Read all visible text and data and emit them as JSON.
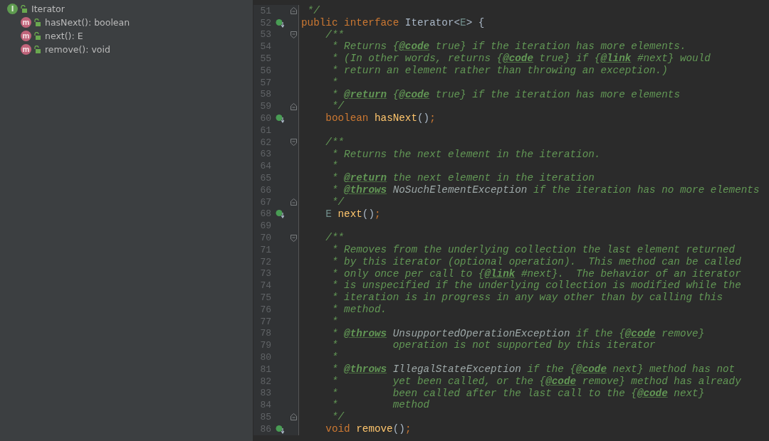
{
  "structure": {
    "items": [
      {
        "kind": "interface",
        "badge": "I",
        "label": "Iterator",
        "children": [
          {
            "kind": "method",
            "badge": "m",
            "label": "hasNext(): boolean"
          },
          {
            "kind": "method",
            "badge": "m",
            "label": "next(): E"
          },
          {
            "kind": "method",
            "badge": "m",
            "label": "remove(): void"
          }
        ]
      }
    ]
  },
  "editor": {
    "lines": [
      {
        "number": "51",
        "implemented": false,
        "fold_start": false,
        "fold_end": true,
        "tokens": [
          {
            "kind": "doc",
            "text": " */"
          }
        ]
      },
      {
        "number": "52",
        "implemented": true,
        "fold_start": false,
        "fold_end": false,
        "tokens": [
          {
            "kind": "keyword",
            "text": "public interface "
          },
          {
            "kind": "plain",
            "text": "Iterator<"
          },
          {
            "kind": "type_param",
            "text": "E"
          },
          {
            "kind": "plain",
            "text": "> {"
          }
        ]
      },
      {
        "number": "53",
        "implemented": false,
        "fold_start": true,
        "fold_end": false,
        "tokens": [
          {
            "kind": "doc",
            "text": "    /**"
          }
        ]
      },
      {
        "number": "54",
        "implemented": false,
        "fold_start": false,
        "fold_end": false,
        "tokens": [
          {
            "kind": "doc",
            "text": "     * Returns {"
          },
          {
            "kind": "doc_tag",
            "text": "@code"
          },
          {
            "kind": "doc",
            "text": " true} if the iteration has more elements."
          }
        ]
      },
      {
        "number": "55",
        "implemented": false,
        "fold_start": false,
        "fold_end": false,
        "tokens": [
          {
            "kind": "doc",
            "text": "     * (In other words, returns {"
          },
          {
            "kind": "doc_tag",
            "text": "@code"
          },
          {
            "kind": "doc",
            "text": " true} if {"
          },
          {
            "kind": "doc_tag",
            "text": "@link"
          },
          {
            "kind": "doc",
            "text": " #next} would"
          }
        ]
      },
      {
        "number": "56",
        "implemented": false,
        "fold_start": false,
        "fold_end": false,
        "tokens": [
          {
            "kind": "doc",
            "text": "     * return an element rather than throwing an exception.)"
          }
        ]
      },
      {
        "number": "57",
        "implemented": false,
        "fold_start": false,
        "fold_end": false,
        "tokens": [
          {
            "kind": "doc",
            "text": "     *"
          }
        ]
      },
      {
        "number": "58",
        "implemented": false,
        "fold_start": false,
        "fold_end": false,
        "tokens": [
          {
            "kind": "doc",
            "text": "     * "
          },
          {
            "kind": "doc_tag",
            "text": "@return"
          },
          {
            "kind": "doc",
            "text": " {"
          },
          {
            "kind": "doc_tag",
            "text": "@code"
          },
          {
            "kind": "doc",
            "text": " true} if the iteration has more elements"
          }
        ]
      },
      {
        "number": "59",
        "implemented": false,
        "fold_start": false,
        "fold_end": true,
        "tokens": [
          {
            "kind": "doc",
            "text": "     */"
          }
        ]
      },
      {
        "number": "60",
        "implemented": true,
        "fold_start": false,
        "fold_end": false,
        "tokens": [
          {
            "kind": "keyword",
            "text": "    boolean "
          },
          {
            "kind": "method",
            "text": "hasNext"
          },
          {
            "kind": "plain",
            "text": "()"
          },
          {
            "kind": "keyword",
            "text": ";"
          }
        ]
      },
      {
        "number": "61",
        "implemented": false,
        "fold_start": false,
        "fold_end": false
      },
      {
        "number": "62",
        "implemented": false,
        "fold_start": true,
        "fold_end": false,
        "tokens": [
          {
            "kind": "doc",
            "text": "    /**"
          }
        ]
      },
      {
        "number": "63",
        "implemented": false,
        "fold_start": false,
        "fold_end": false,
        "tokens": [
          {
            "kind": "doc",
            "text": "     * Returns the next element in the iteration."
          }
        ]
      },
      {
        "number": "64",
        "implemented": false,
        "fold_start": false,
        "fold_end": false,
        "tokens": [
          {
            "kind": "doc",
            "text": "     *"
          }
        ]
      },
      {
        "number": "65",
        "implemented": false,
        "fold_start": false,
        "fold_end": false,
        "tokens": [
          {
            "kind": "doc",
            "text": "     * "
          },
          {
            "kind": "doc_tag",
            "text": "@return"
          },
          {
            "kind": "doc",
            "text": " the next element in the iteration"
          }
        ]
      },
      {
        "number": "66",
        "implemented": false,
        "fold_start": false,
        "fold_end": false,
        "tokens": [
          {
            "kind": "doc",
            "text": "     * "
          },
          {
            "kind": "doc_tag",
            "text": "@throws"
          },
          {
            "kind": "doc_ref",
            "text": " NoSuchElementException"
          },
          {
            "kind": "doc",
            "text": " if the iteration has no more elements"
          }
        ]
      },
      {
        "number": "67",
        "implemented": false,
        "fold_start": false,
        "fold_end": true,
        "tokens": [
          {
            "kind": "doc",
            "text": "     */"
          }
        ]
      },
      {
        "number": "68",
        "implemented": true,
        "fold_start": false,
        "fold_end": false,
        "tokens": [
          {
            "kind": "type_param",
            "text": "    E "
          },
          {
            "kind": "method",
            "text": "next"
          },
          {
            "kind": "plain",
            "text": "()"
          },
          {
            "kind": "keyword",
            "text": ";"
          }
        ]
      },
      {
        "number": "69",
        "implemented": false,
        "fold_start": false,
        "fold_end": false
      },
      {
        "number": "70",
        "implemented": false,
        "fold_start": true,
        "fold_end": false,
        "tokens": [
          {
            "kind": "doc",
            "text": "    /**"
          }
        ]
      },
      {
        "number": "71",
        "implemented": false,
        "fold_start": false,
        "fold_end": false,
        "tokens": [
          {
            "kind": "doc",
            "text": "     * Removes from the underlying collection the last element returned"
          }
        ]
      },
      {
        "number": "72",
        "implemented": false,
        "fold_start": false,
        "fold_end": false,
        "tokens": [
          {
            "kind": "doc",
            "text": "     * by this iterator (optional operation).  This method can be called"
          }
        ]
      },
      {
        "number": "73",
        "implemented": false,
        "fold_start": false,
        "fold_end": false,
        "tokens": [
          {
            "kind": "doc",
            "text": "     * only once per call to {"
          },
          {
            "kind": "doc_tag",
            "text": "@link"
          },
          {
            "kind": "doc",
            "text": " #next}.  The behavior of an iterator"
          }
        ]
      },
      {
        "number": "74",
        "implemented": false,
        "fold_start": false,
        "fold_end": false,
        "tokens": [
          {
            "kind": "doc",
            "text": "     * is unspecified if the underlying collection is modified while the"
          }
        ]
      },
      {
        "number": "75",
        "implemented": false,
        "fold_start": false,
        "fold_end": false,
        "tokens": [
          {
            "kind": "doc",
            "text": "     * iteration is in progress in any way other than by calling this"
          }
        ]
      },
      {
        "number": "76",
        "implemented": false,
        "fold_start": false,
        "fold_end": false,
        "tokens": [
          {
            "kind": "doc",
            "text": "     * method."
          }
        ]
      },
      {
        "number": "77",
        "implemented": false,
        "fold_start": false,
        "fold_end": false,
        "tokens": [
          {
            "kind": "doc",
            "text": "     *"
          }
        ]
      },
      {
        "number": "78",
        "implemented": false,
        "fold_start": false,
        "fold_end": false,
        "tokens": [
          {
            "kind": "doc",
            "text": "     * "
          },
          {
            "kind": "doc_tag",
            "text": "@throws"
          },
          {
            "kind": "doc_ref",
            "text": " UnsupportedOperationException"
          },
          {
            "kind": "doc",
            "text": " if the {"
          },
          {
            "kind": "doc_tag",
            "text": "@code"
          },
          {
            "kind": "doc",
            "text": " remove}"
          }
        ]
      },
      {
        "number": "79",
        "implemented": false,
        "fold_start": false,
        "fold_end": false,
        "tokens": [
          {
            "kind": "doc",
            "text": "     *         operation is not supported by this iterator"
          }
        ]
      },
      {
        "number": "80",
        "implemented": false,
        "fold_start": false,
        "fold_end": false,
        "tokens": [
          {
            "kind": "doc",
            "text": "     *"
          }
        ]
      },
      {
        "number": "81",
        "implemented": false,
        "fold_start": false,
        "fold_end": false,
        "tokens": [
          {
            "kind": "doc",
            "text": "     * "
          },
          {
            "kind": "doc_tag",
            "text": "@throws"
          },
          {
            "kind": "doc_ref",
            "text": " IllegalStateException"
          },
          {
            "kind": "doc",
            "text": " if the {"
          },
          {
            "kind": "doc_tag",
            "text": "@code"
          },
          {
            "kind": "doc",
            "text": " next} method has not"
          }
        ]
      },
      {
        "number": "82",
        "implemented": false,
        "fold_start": false,
        "fold_end": false,
        "tokens": [
          {
            "kind": "doc",
            "text": "     *         yet been called, or the {"
          },
          {
            "kind": "doc_tag",
            "text": "@code"
          },
          {
            "kind": "doc",
            "text": " remove} method has already"
          }
        ]
      },
      {
        "number": "83",
        "implemented": false,
        "fold_start": false,
        "fold_end": false,
        "tokens": [
          {
            "kind": "doc",
            "text": "     *         been called after the last call to the {"
          },
          {
            "kind": "doc_tag",
            "text": "@code"
          },
          {
            "kind": "doc",
            "text": " next}"
          }
        ]
      },
      {
        "number": "84",
        "implemented": false,
        "fold_start": false,
        "fold_end": false,
        "tokens": [
          {
            "kind": "doc",
            "text": "     *         method"
          }
        ]
      },
      {
        "number": "85",
        "implemented": false,
        "fold_start": false,
        "fold_end": true,
        "tokens": [
          {
            "kind": "doc",
            "text": "     */"
          }
        ]
      },
      {
        "number": "86",
        "implemented": true,
        "fold_start": false,
        "fold_end": false,
        "tokens": [
          {
            "kind": "keyword",
            "text": "    void "
          },
          {
            "kind": "method",
            "text": "remove"
          },
          {
            "kind": "plain",
            "text": "()"
          },
          {
            "kind": "keyword",
            "text": ";"
          }
        ]
      }
    ]
  }
}
